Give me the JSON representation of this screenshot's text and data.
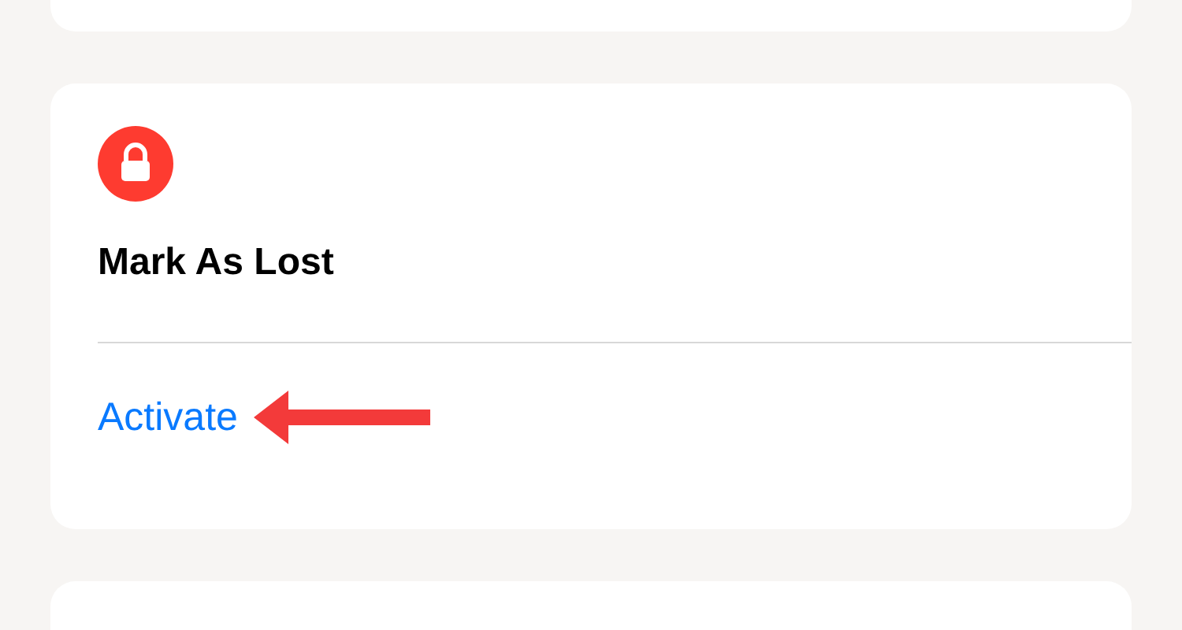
{
  "lost_mode": {
    "title": "Mark As Lost",
    "action": "Activate"
  }
}
